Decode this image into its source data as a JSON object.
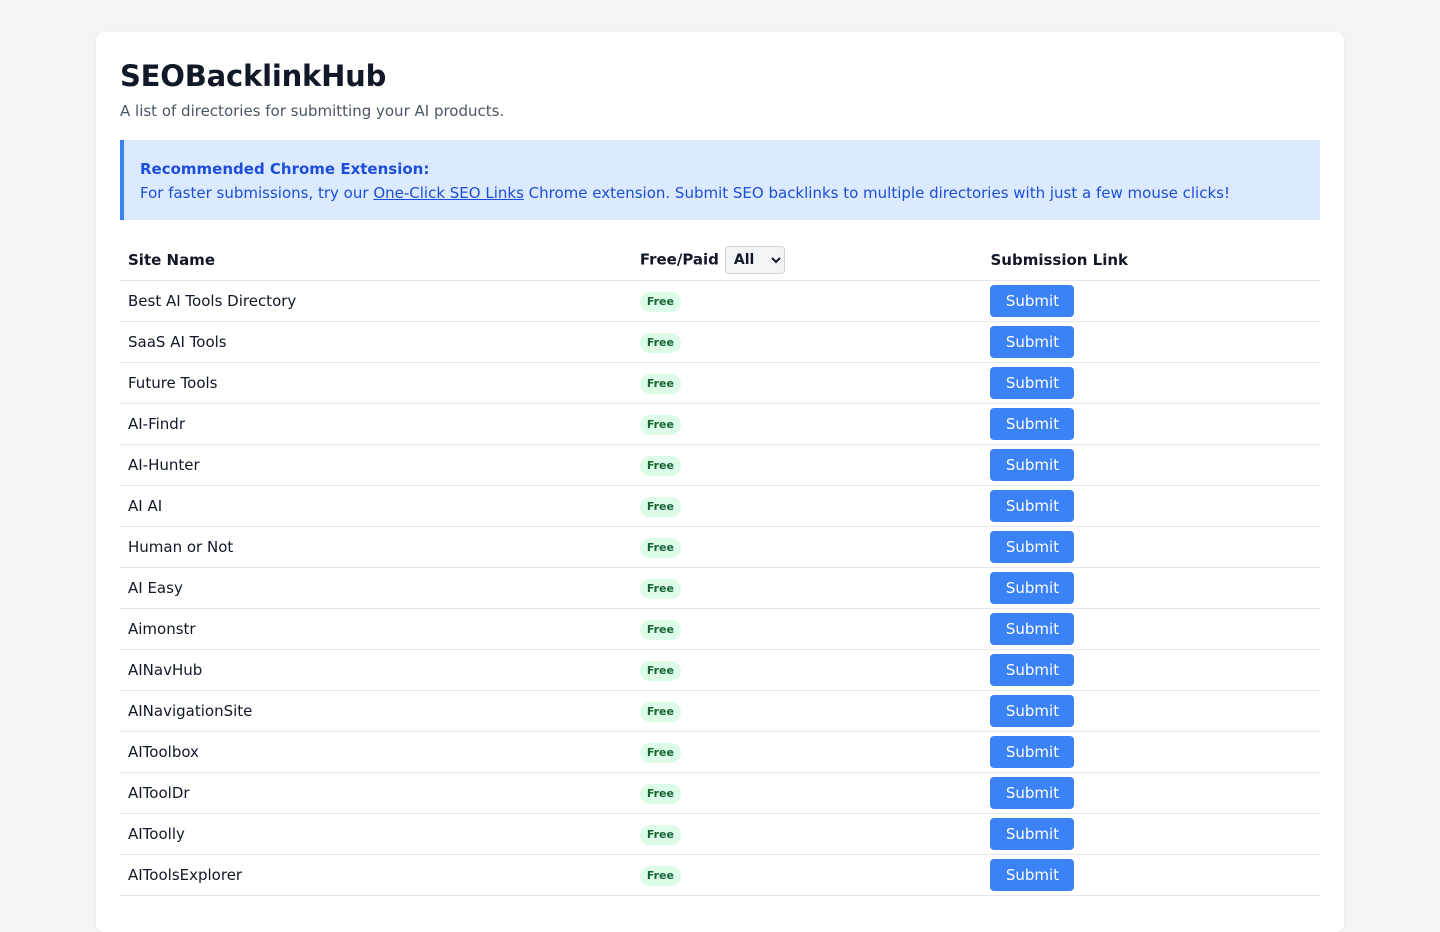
{
  "header": {
    "title": "SEOBacklinkHub",
    "subtitle": "A list of directories for submitting your AI products."
  },
  "notice": {
    "title": "Recommended Chrome Extension:",
    "text_before": "For faster submissions, try our ",
    "link_text": "One-Click SEO Links",
    "text_after": " Chrome extension. Submit SEO backlinks to multiple directories with just a few mouse clicks!"
  },
  "table": {
    "columns": {
      "site_name": "Site Name",
      "free_paid": "Free/Paid",
      "submission_link": "Submission Link"
    },
    "filter": {
      "selected": "All"
    },
    "rows": [
      {
        "name": "Best AI Tools Directory",
        "type": "Free",
        "action": "Submit"
      },
      {
        "name": "SaaS AI Tools",
        "type": "Free",
        "action": "Submit"
      },
      {
        "name": "Future Tools",
        "type": "Free",
        "action": "Submit"
      },
      {
        "name": "AI-Findr",
        "type": "Free",
        "action": "Submit"
      },
      {
        "name": "AI-Hunter",
        "type": "Free",
        "action": "Submit"
      },
      {
        "name": "AI AI",
        "type": "Free",
        "action": "Submit"
      },
      {
        "name": "Human or Not",
        "type": "Free",
        "action": "Submit"
      },
      {
        "name": "AI Easy",
        "type": "Free",
        "action": "Submit"
      },
      {
        "name": "Aimonstr",
        "type": "Free",
        "action": "Submit"
      },
      {
        "name": "AINavHub",
        "type": "Free",
        "action": "Submit"
      },
      {
        "name": "AINavigationSite",
        "type": "Free",
        "action": "Submit"
      },
      {
        "name": "AIToolbox",
        "type": "Free",
        "action": "Submit"
      },
      {
        "name": "AIToolDr",
        "type": "Free",
        "action": "Submit"
      },
      {
        "name": "AIToolly",
        "type": "Free",
        "action": "Submit"
      },
      {
        "name": "AIToolsExplorer",
        "type": "Free",
        "action": "Submit"
      }
    ]
  },
  "colors": {
    "accent": "#3b82f6",
    "notice_bg": "#dbeafe",
    "badge_bg": "#dcfce7",
    "badge_text": "#166534"
  }
}
